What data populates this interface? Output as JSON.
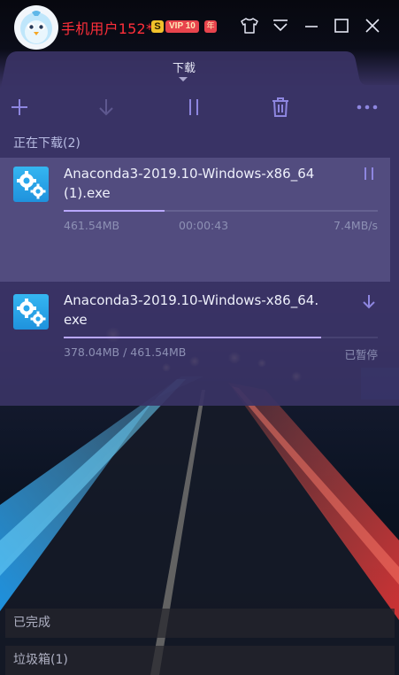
{
  "window": {
    "username": "手机用户152*",
    "badges": {
      "super": "S",
      "vip": "VIP 10",
      "year": "年"
    }
  },
  "icons": {
    "skin": "shirt-icon",
    "menu": "dropdown-menu-icon",
    "minimize": "minimize-icon",
    "maximize": "maximize-icon",
    "close": "close-icon",
    "add": "plus-icon",
    "start": "download-arrow-icon",
    "pause": "pause-icon",
    "delete": "trash-icon",
    "more": "more-dots-icon",
    "file": "gear-file-icon"
  },
  "colors": {
    "username": "#ff2f3a",
    "progress": "#b9a7ff",
    "accent_icon": "#8e86e0",
    "file_icon": "#2aa7ec"
  },
  "tab": {
    "label": "下载"
  },
  "downloading": {
    "section_label": "正在下载(2)",
    "items": [
      {
        "name": "Anaconda3-2019.10-Windows-x86_64(1).exe",
        "size": "461.54MB",
        "time": "00:00:43",
        "speed": "7.4MB/s",
        "progress": 0.32,
        "action": "pause"
      },
      {
        "name": "Anaconda3-2019.10-Windows-x86_64.exe",
        "size": "378.04MB / 461.54MB",
        "status": "已暂停",
        "progress": 0.82,
        "action": "resume"
      }
    ]
  },
  "footer": {
    "completed": "已完成",
    "trash": "垃圾箱(1)"
  }
}
